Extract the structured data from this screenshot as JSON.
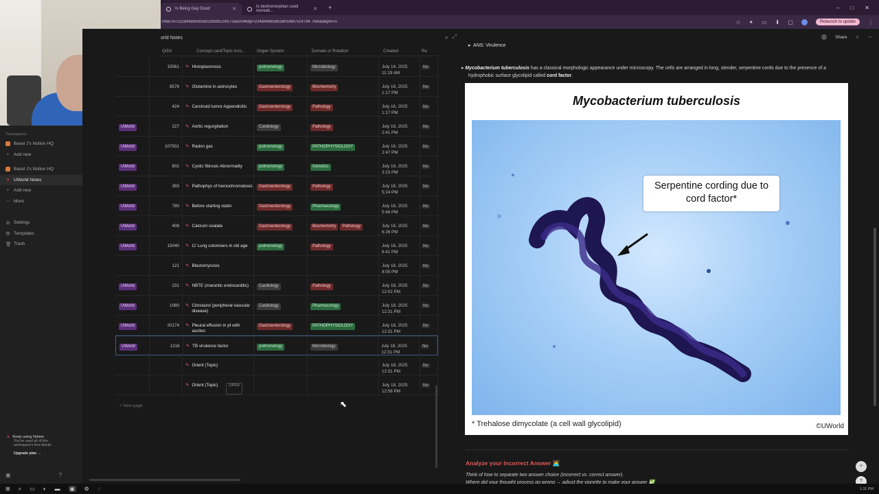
{
  "browser": {
    "tabs": [
      {
        "label": "Is Being Gay Good",
        "active": true
      },
      {
        "label": "Is dextromorphan used recreati...",
        "active": false
      }
    ],
    "new_tab": "+",
    "url": "0fde7e=222d49e656558193995100c7cee00468p=234d49e656558054bf7cc4794 7fe6ad&pm=s",
    "relaunch_label": "Relaunch to update",
    "window_controls": [
      "–",
      "□",
      "✕"
    ]
  },
  "sidebar": {
    "teamspaces_label": "Teamspaces",
    "items": [
      {
        "label": "Basel J's Notion HQ",
        "icon": "workspace-icon"
      },
      {
        "label": "Add new",
        "icon": "plus-icon"
      },
      {
        "label": "Basel J's Notion HQ",
        "icon": "workspace-icon"
      },
      {
        "label": "UWorld Notes",
        "icon": "database-icon",
        "selected": true
      },
      {
        "label": "Add new",
        "icon": "plus-icon"
      },
      {
        "label": "More",
        "icon": "more-icon"
      }
    ],
    "settings": [
      {
        "label": "Settings",
        "icon": "gear-icon"
      },
      {
        "label": "Templates",
        "icon": "template-icon"
      },
      {
        "label": "Trash",
        "icon": "trash-icon"
      }
    ],
    "upgrade": {
      "title": "Keep using Notion",
      "line1": "You've used all of this",
      "line2": "workspace's free blocks",
      "cta": "Upgrade plan →"
    }
  },
  "table": {
    "title": "orld Notes",
    "headers": [
      "QID#",
      "Concept card/Topic inco...",
      "Organ System",
      "Domain or Rotation",
      "Created",
      "Re"
    ],
    "rows": [
      {
        "source": "",
        "qid": "15061",
        "concept": "Histoplasmosis",
        "organ": "pulmonology",
        "domain": [
          "Microbiology"
        ],
        "created": [
          "July 14, 2025",
          "11:19 AM"
        ],
        "re": "No"
      },
      {
        "source": "",
        "qid": "8578",
        "concept": "Glutamine in astrocytes",
        "organ": "Gastroenterology",
        "domain": [
          "Biochemistry"
        ],
        "created": [
          "July 16, 2025",
          "1:17 PM"
        ],
        "re": "No"
      },
      {
        "source": "",
        "qid": "424",
        "concept": "Carcinoid tumor Appendicitis",
        "organ": "Gastroenterology",
        "domain": [
          "Pathology"
        ],
        "created": [
          "July 16, 2025",
          "1:17 PM"
        ],
        "re": "No"
      },
      {
        "source": "UWorld",
        "qid": "227",
        "concept": "Aortic regurgitation",
        "organ": "Cardiology",
        "domain": [
          "Pathology"
        ],
        "created": [
          "July 16, 2025",
          "2:41 PM"
        ],
        "re": "No"
      },
      {
        "source": "UWorld",
        "qid": "107931",
        "concept": "Radon gas",
        "organ": "pulmonology",
        "domain": [
          "PATHOPHYSIOLOGY"
        ],
        "created": [
          "July 16, 2025",
          "2:47 PM"
        ],
        "re": "No"
      },
      {
        "source": "UWorld",
        "qid": "802",
        "concept": "Cystic fibrosis Abnormality",
        "organ": "pulmonology",
        "domain": [
          "Genetics"
        ],
        "created": [
          "July 16, 2025",
          "3:23 PM"
        ],
        "re": "No"
      },
      {
        "source": "UWorld",
        "qid": "393",
        "concept": "Pathophys of hemochromatosis",
        "organ": "Gastroenterology",
        "domain": [
          "Pathology"
        ],
        "created": [
          "July 16, 2025",
          "5:24 PM"
        ],
        "re": "No"
      },
      {
        "source": "UWorld",
        "qid": "780",
        "concept": "Before starting statin",
        "organ": "Gastroenterology",
        "domain": [
          "Pharmacology"
        ],
        "created": [
          "July 16, 2025",
          "5:46 PM"
        ],
        "re": "No"
      },
      {
        "source": "UWorld",
        "qid": "408",
        "concept": "Calcium oxalate",
        "organ": "Gastroenterology",
        "domain": [
          "Biochemistry",
          "Pathology"
        ],
        "created": [
          "July 16, 2025",
          "6:26 PM"
        ],
        "re": "No"
      },
      {
        "source": "UWorld",
        "qid": "15040",
        "concept": "C/ Lung colonisers in old age",
        "organ": "pulmonology",
        "domain": [
          "Pathology"
        ],
        "created": [
          "July 16, 2025",
          "6:41 PM"
        ],
        "re": "No"
      },
      {
        "source": "",
        "qid": "121",
        "concept": "Blastomycosis",
        "organ": "",
        "domain": [],
        "created": [
          "July 16, 2025",
          "8:05 PM"
        ],
        "re": "No"
      },
      {
        "source": "UWorld",
        "qid": "231",
        "concept": "NBTE (marantic endocarditis)",
        "organ": "Cardiology",
        "domain": [
          "Pathology"
        ],
        "created": [
          "July 18, 2025",
          "12:02 PM"
        ],
        "re": "No"
      },
      {
        "source": "UWorld",
        "qid": "1080",
        "concept": "Cilostazol (peripheral vascular disease)",
        "organ": "Cardiology",
        "domain": [
          "Pharmacology"
        ],
        "created": [
          "July 18, 2025",
          "12:31 PM"
        ],
        "re": "No"
      },
      {
        "source": "UWorld",
        "qid": "20174",
        "concept": "Pleural effusion in pt with ascites",
        "organ": "Gastroenterology",
        "domain": [
          "PATHOPHYSIOLOGY"
        ],
        "created": [
          "July 18, 2025",
          "12:31 PM"
        ],
        "re": "No"
      },
      {
        "source": "UWorld",
        "qid": "1216",
        "concept": "TB virulence factor",
        "organ": "pulmonology",
        "domain": [
          "Microbiology"
        ],
        "created": [
          "July 18, 2025",
          "12:31 PM"
        ],
        "re": "No",
        "selected": true
      },
      {
        "source": "",
        "qid": "",
        "concept": "Orient (Topic)",
        "organ": "",
        "domain": [],
        "created": [
          "July 18, 2025",
          "12:31 PM"
        ],
        "re": "No"
      },
      {
        "source": "",
        "qid": "",
        "concept": "Orient (Topic)",
        "organ": "",
        "domain": [],
        "created": [
          "July 18, 2025",
          "12:58 PM"
        ],
        "re": "No",
        "open": "OPEN"
      }
    ],
    "new_page": "+ New page"
  },
  "peek": {
    "share": "Share",
    "toggle": "ANS: Virulence",
    "desc_italic": "Mycobacterium tuberculosis",
    "desc_text": " has a classical morphologic appearance under microscopy. The cells are arranged in long, slender, serpentine cords due to the presence of a hydrophobic surface glycolipid called ",
    "desc_bold": "cord factor",
    "desc_end": ".",
    "figure": {
      "title": "Mycobacterium tuberculosis",
      "callout": "Serpentine cording due to cord factor*",
      "note": "* Trehalose dimycolate (a cell wall glycolipid)",
      "copyright": "©UWorld"
    },
    "analyze_title": "Analyze your Incorrect Answer 🧑‍💻",
    "analyze_line1": "Think of how to separate two answer choice (incorrect vs. correct answer).",
    "analyze_line2": "Where did your thought process go wrong → adjust the vignette to make your answer ✅"
  },
  "taskbar": {
    "clock": "1:11 PM"
  },
  "colors": {
    "uworld_tag": "#5b2f7a",
    "green_tag": "#2b6b3f",
    "red_tag": "#6e2a2a",
    "accent_analyze": "#e35a5a"
  }
}
